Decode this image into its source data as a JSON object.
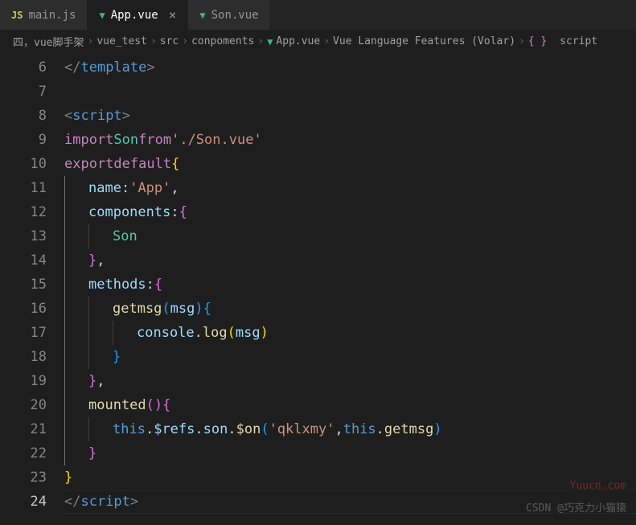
{
  "tabs": [
    {
      "icon": "JS",
      "label": "main.js",
      "active": false
    },
    {
      "icon": "V",
      "label": "App.vue",
      "active": true
    },
    {
      "icon": "V",
      "label": "Son.vue",
      "active": false
    }
  ],
  "breadcrumbs": {
    "items": [
      {
        "label": "四，vue脚手架"
      },
      {
        "label": "vue_test"
      },
      {
        "label": "src"
      },
      {
        "label": "conpoments"
      },
      {
        "label": "App.vue",
        "icon": "vue"
      },
      {
        "label": "Vue Language Features (Volar)"
      },
      {
        "label": "script",
        "icon": "braces"
      }
    ]
  },
  "gutter_start": 6,
  "gutter_end": 24,
  "active_line": 24,
  "code": {
    "l6": {
      "tag_open": "</",
      "tag_name": "template",
      "tag_close": ">"
    },
    "l8": {
      "tag_open": "<",
      "tag_name": "script",
      "tag_close": ">"
    },
    "l9": {
      "kw1": "import",
      "cls": "Son",
      "kw2": "from",
      "str": "'./Son.vue'"
    },
    "l10": {
      "kw1": "export",
      "kw2": "default",
      "brace": "{"
    },
    "l11": {
      "prop": "name",
      "punct": ":",
      "str": "'App'",
      "comma": ","
    },
    "l12": {
      "prop": "components",
      "punct": ":",
      "brace": "{"
    },
    "l13": {
      "cls": "Son"
    },
    "l14": {
      "brace": "}",
      "comma": ","
    },
    "l15": {
      "prop": "methods",
      "punct": ":",
      "brace": "{"
    },
    "l16": {
      "fn": "getmsg",
      "paren_o": "(",
      "arg": "msg",
      "paren_c": ")",
      "brace": "{"
    },
    "l17": {
      "obj": "console",
      "dot": ".",
      "fn": "log",
      "paren_o": "(",
      "arg": "msg",
      "paren_c": ")"
    },
    "l18": {
      "brace": "}"
    },
    "l19": {
      "brace": "}",
      "comma": ","
    },
    "l20": {
      "fn": "mounted",
      "paren_o": "(",
      "paren_c": ")",
      "brace": "{"
    },
    "l21": {
      "this": "this",
      "dot1": ".",
      "prop1": "$refs",
      "dot2": ".",
      "prop2": "son",
      "dot3": ".",
      "fn": "$on",
      "paren_o": "(",
      "str": "'qklxmy'",
      "comma": ",",
      "this2": "this",
      "dot4": ".",
      "prop3": "getmsg",
      "paren_c": ")"
    },
    "l22": {
      "brace": "}"
    },
    "l23": {
      "brace": "}"
    },
    "l24": {
      "tag_open": "</",
      "tag_name": "script",
      "tag_close": ">"
    }
  },
  "watermarks": {
    "w1": "Yuucn.com",
    "w2": "CSDN @巧克力小猫猿"
  }
}
